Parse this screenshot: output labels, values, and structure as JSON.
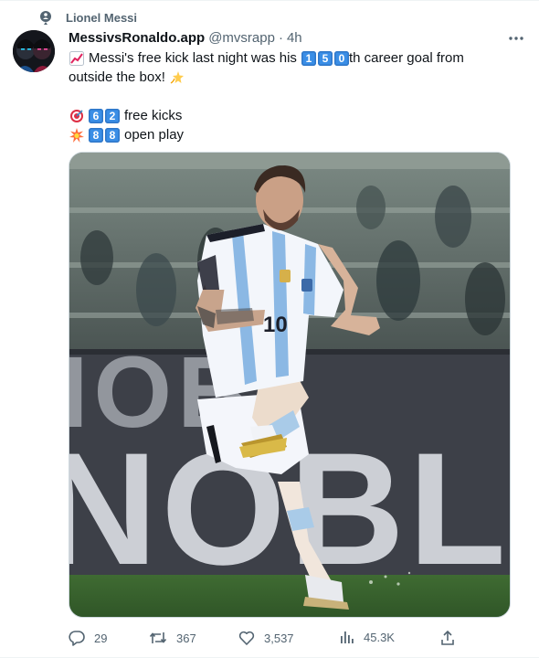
{
  "social_context": {
    "label": "Lionel Messi",
    "icon": "community-icon"
  },
  "author": {
    "display_name": "MessivsRonaldo.app",
    "handle": "@mvsrapp",
    "separator": "·",
    "time": "4h",
    "avatar": "avatar-two-faces"
  },
  "tweet": {
    "line1_emoji": "chart-increasing-emoji",
    "line1_before": "Messi's free kick last night was his",
    "goal_digits": [
      "1",
      "5",
      "0"
    ],
    "line1_after": "th career goal from",
    "line2_text": "outside the box!",
    "line2_emoji": "dizzy-emoji",
    "stats": [
      {
        "emoji": "direct-hit-emoji",
        "digits": [
          "6",
          "2"
        ],
        "label": "free kicks"
      },
      {
        "emoji": "collision-emoji",
        "digits": [
          "8",
          "8"
        ],
        "label": "open play"
      }
    ]
  },
  "media": {
    "description_icon": "photo-of-player-taking-free-kick",
    "jersey_number": "10",
    "board_text": "NOBL"
  },
  "actions": {
    "replies": "29",
    "reposts": "367",
    "likes": "3,537",
    "views": "45.3K"
  },
  "colors": {
    "text_primary": "#0f1419",
    "text_secondary": "#536471",
    "keycap": "#3a8ee6",
    "divider": "#eff3f4"
  }
}
